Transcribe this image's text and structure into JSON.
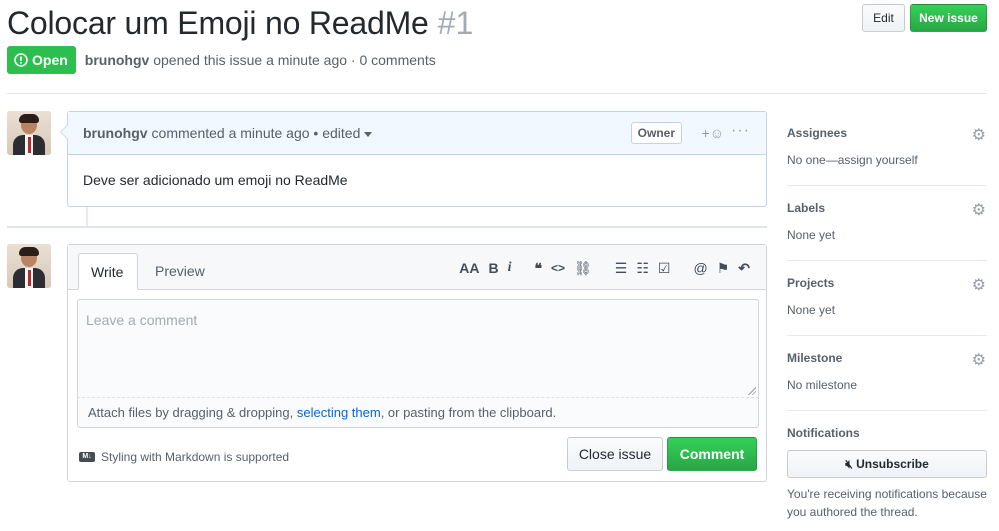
{
  "issue": {
    "title": "Colocar um Emoji no ReadMe",
    "number": "#1",
    "state": "Open",
    "author": "brunohgv",
    "meta": "opened this issue a minute ago · 0 comments"
  },
  "header_actions": {
    "edit_label": "Edit",
    "new_issue_label": "New issue"
  },
  "comment": {
    "author": "brunohgv",
    "meta": "commented a minute ago • edited",
    "badge": "Owner",
    "reaction_icon": "+☺",
    "more_icon": "···",
    "body": "Deve ser adicionado um emoji no ReadMe"
  },
  "editor": {
    "tabs": [
      "Write",
      "Preview"
    ],
    "toolbar": {
      "header": "AA",
      "bold": "B",
      "italic": "i",
      "quote": "❝",
      "code": "<>",
      "link": "⛓",
      "bullet_list": "☰",
      "numbered_list": "☷",
      "task_list": "☑",
      "mention": "@",
      "reference": "⚑",
      "reply": "↶"
    },
    "placeholder": "Leave a comment",
    "attach_prefix": "Attach files by dragging & dropping, ",
    "attach_link": "selecting them",
    "attach_suffix": ", or pasting from the clipboard.",
    "markdown_note": "Styling with Markdown is supported",
    "close_label": "Close issue",
    "comment_label": "Comment"
  },
  "sidebar": {
    "assignees": {
      "title": "Assignees",
      "value": "No one—assign yourself"
    },
    "labels": {
      "title": "Labels",
      "value": "None yet"
    },
    "projects": {
      "title": "Projects",
      "value": "None yet"
    },
    "milestone": {
      "title": "Milestone",
      "value": "No milestone"
    },
    "notifications": {
      "title": "Notifications",
      "button": "Unsubscribe",
      "description": "You're receiving notifications because you authored the thread."
    }
  },
  "colors": {
    "green": "#2cbe4e",
    "link": "#0366d6",
    "comment_header_bg": "#f1f8ff"
  }
}
